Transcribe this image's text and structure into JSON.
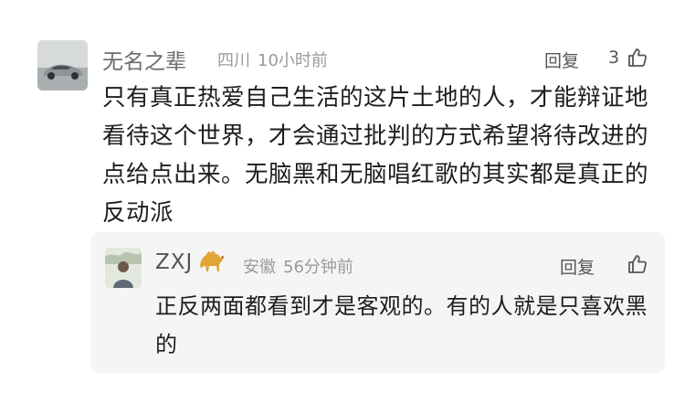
{
  "comment": {
    "username": "无名之辈",
    "location": "四川",
    "time": "10小时前",
    "reply_label": "回复",
    "like_count": "3",
    "text": "只有真正热爱自己生活的这片土地的人，才能辩证地看待这个世界，才会通过批判的方式希望将待改进的点给点出来。无脑黑和无脑唱红歌的其实都是真正的反动派"
  },
  "reply": {
    "username": "ZXJ",
    "location": "安徽",
    "time": "56分钟前",
    "reply_label": "回复",
    "text": "正反两面都看到才是客观的。有的人就是只喜欢黑的"
  },
  "icons": {
    "avatar": "car-photo-avatar",
    "reply_avatar": "person-photo-avatar",
    "badge": "camel-icon",
    "like": "thumbs-up-icon"
  }
}
